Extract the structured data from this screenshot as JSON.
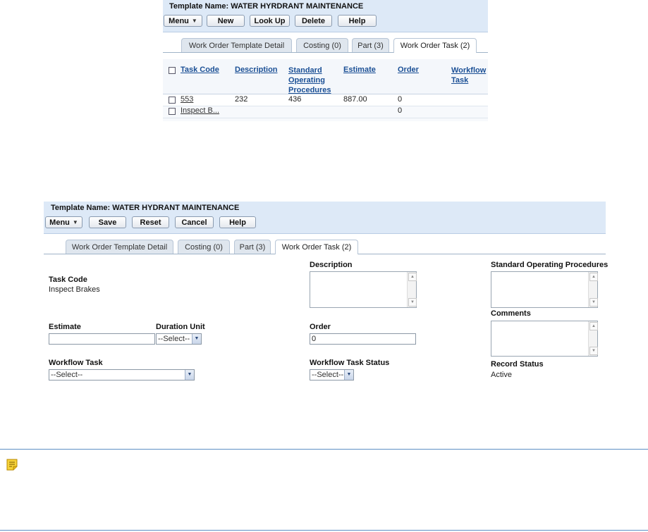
{
  "top": {
    "header_title": "Template Name: WATER HYRDRANT MAINTENANCE",
    "buttons": {
      "menu": "Menu",
      "new": "New",
      "lookup": "Look Up",
      "delete": "Delete",
      "help": "Help"
    },
    "tabs": [
      "Work Order Template Detail",
      "Costing (0)",
      "Part (3)",
      "Work Order Task (2)"
    ],
    "columns": {
      "task_code": "Task Code",
      "description": "Description",
      "sop_1": "Standard",
      "sop_2": "Operating",
      "sop_3": "Procedures",
      "estimate": "Estimate",
      "order": "Order",
      "workflow_1": "Workflow",
      "workflow_2": "Task"
    },
    "rows": [
      {
        "task_code": "553",
        "description": "232",
        "sop": "436",
        "estimate": "887.00",
        "order": "0"
      },
      {
        "task_code": "Inspect B...",
        "description": "",
        "sop": "",
        "estimate": "",
        "order": "0"
      }
    ]
  },
  "bottom": {
    "header_title": "Template Name: WATER HYDRANT MAINTENANCE",
    "buttons": {
      "menu": "Menu",
      "save": "Save",
      "reset": "Reset",
      "cancel": "Cancel",
      "help": "Help"
    },
    "tabs": [
      "Work Order Template Detail",
      "Costing (0)",
      "Part (3)",
      "Work Order Task (2)"
    ],
    "form": {
      "task_code_label": "Task Code",
      "task_code_value": "Inspect Brakes",
      "description_label": "Description",
      "sop_label": "Standard Operating Procedures",
      "comments_label": "Comments",
      "estimate_label": "Estimate",
      "estimate_value": "",
      "duration_unit_label": "Duration Unit",
      "duration_unit_value": "--Select--",
      "order_label": "Order",
      "order_value": "0",
      "workflow_task_label": "Workflow Task",
      "workflow_task_value": "--Select--",
      "workflow_task_status_label": "Workflow Task Status",
      "workflow_task_status_value": "--Select--",
      "record_status_label": "Record Status",
      "record_status_value": "Active"
    }
  },
  "note": {
    "icon": "note-icon"
  }
}
